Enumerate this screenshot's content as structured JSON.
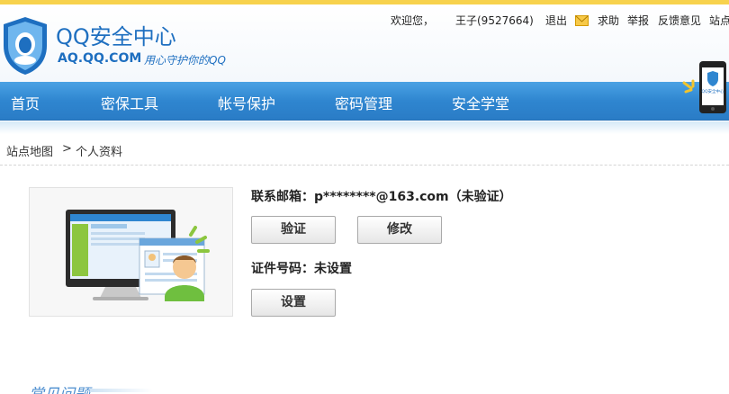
{
  "colors": {
    "brand_blue": "#1e6fc0",
    "nav_blue": "#2f86d0",
    "top_strip": "#f7d24d",
    "mail_icon": "#f0b400"
  },
  "logo": {
    "title": "QQ安全中心",
    "domain": "AQ.QQ.COM",
    "slogan": "用心守护你的QQ",
    "icon": "qq-shield-logo-icon"
  },
  "user_bar": {
    "welcome": "欢迎您，",
    "username": "王子(9527664)",
    "logout": "退出",
    "help": "求助",
    "report": "举报",
    "feedback": "反馈意见",
    "sitemap_partial": "站点"
  },
  "nav": {
    "items": [
      "首页",
      "密保工具",
      "帐号保护",
      "密码管理",
      "安全学堂"
    ]
  },
  "phone_badge": {
    "text": "QQ安全中心"
  },
  "breadcrumb": {
    "root": "站点地图",
    "separator": ">",
    "current": "个人资料"
  },
  "profile": {
    "email_label": "联系邮箱：",
    "email_value": "p********@163.com",
    "email_status": "（未验证）",
    "verify_button": "验证",
    "modify_button": "修改",
    "id_label": "证件号码：",
    "id_value": "未设置",
    "set_button": "设置"
  },
  "faq": {
    "title": "常见问题"
  }
}
